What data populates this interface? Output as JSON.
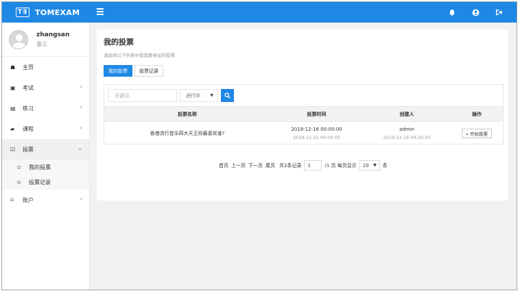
{
  "app": {
    "logo_text": "T∃",
    "name": "TOMEXAM"
  },
  "colors": {
    "primary": "#1e88e5",
    "sidebar_bg": "#ffffff",
    "content_bg": "#f2f2f2"
  },
  "topbar": {
    "icons": [
      "bell-icon",
      "user-icon",
      "logout-icon"
    ]
  },
  "user": {
    "name": "zhangsan",
    "display_name": "张三"
  },
  "sidebar": {
    "items": [
      {
        "label": "主页",
        "icon": "home-icon",
        "glyph": "☗"
      },
      {
        "label": "考试",
        "icon": "calendar-check-icon",
        "glyph": "▣",
        "chevron": "›"
      },
      {
        "label": "练习",
        "icon": "calendar-icon",
        "glyph": "▤",
        "chevron": "›"
      },
      {
        "label": "课程",
        "icon": "book-icon",
        "glyph": "▰",
        "chevron": "›"
      },
      {
        "label": "投票",
        "icon": "checkbox-icon",
        "glyph": "☑",
        "chevron": "⌄"
      },
      {
        "label": "账户",
        "icon": "lock-icon",
        "glyph": "⍝",
        "chevron": "›"
      }
    ],
    "vote_sub_items": [
      {
        "label": "我的投票"
      },
      {
        "label": "投票记录"
      }
    ]
  },
  "main": {
    "title": "我的投票",
    "subtitle": "请选择以下列表中我需要参加的投票",
    "tabs": [
      {
        "label": "我的投票",
        "active": true
      },
      {
        "label": "投票记录",
        "active": false
      }
    ],
    "search": {
      "placeholder": "关键词",
      "status_value": "进行中"
    },
    "table": {
      "headers": [
        "投票名称",
        "投票时间",
        "创建人",
        "操作"
      ],
      "rows": [
        {
          "name": "香港流行音乐四大天王你最喜欢谁?",
          "start_time": "2019-12-16 00:00:00",
          "end_time": "2019-12-31 00:00:00",
          "creator": "admin",
          "created_at": "2019-12-16 09:20:50",
          "action": "» 开始投票"
        }
      ]
    },
    "pagination": {
      "first": "首页",
      "prev": "上一页",
      "next": "下一页",
      "last": "尾页",
      "total_text": "共1条记录",
      "page_value": "1",
      "page_suffix": "/1 页 每页显示",
      "page_size": "10",
      "size_unit": "条"
    }
  }
}
